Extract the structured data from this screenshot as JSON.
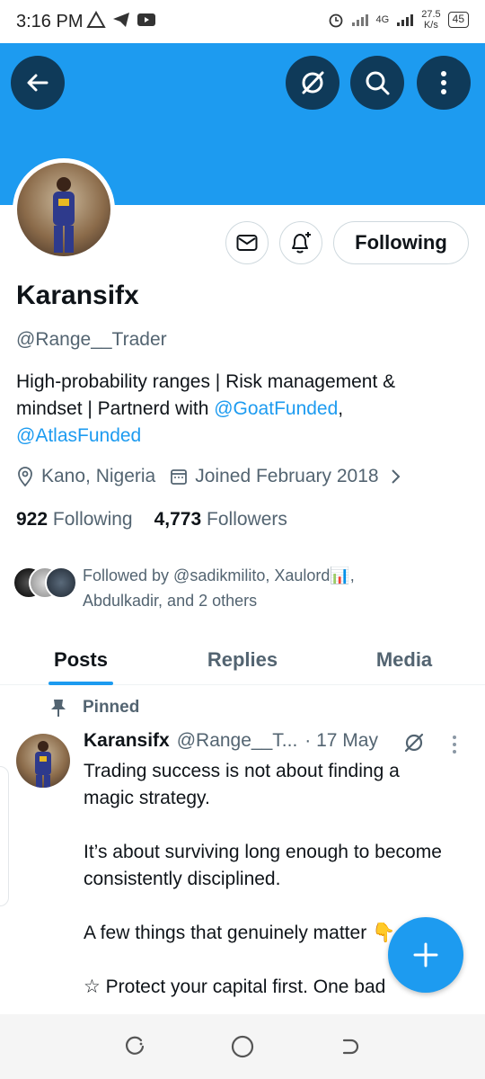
{
  "status_bar": {
    "time": "3:16 PM",
    "network_label": "4G",
    "speed_value": "27.5",
    "speed_unit": "K/s",
    "battery": "45"
  },
  "header": {
    "back_icon": "arrow-left-icon",
    "grok_icon": "grok-icon",
    "search_icon": "search-icon",
    "more_icon": "more-vertical-icon",
    "banner_color": "#1d9bf0"
  },
  "profile": {
    "display_name": "Karansifx",
    "handle": "@Range__Trader",
    "bio_text_1": "High-probability ranges | Risk management & mindset | Partnerd with ",
    "bio_mention_1": "@GoatFunded",
    "bio_text_2": ",",
    "bio_mention_2": "@AtlasFunded",
    "location": "Kano, Nigeria",
    "joined": "Joined February 2018",
    "following_count": "922",
    "following_label": "Following",
    "followers_count": "4,773",
    "followers_label": "Followers",
    "followed_by": "Followed by @sadikmilito, Xaulord📊, Abdulkadir, and 2 others"
  },
  "actions": {
    "message_icon": "mail-icon",
    "notify_icon": "bell-plus-icon",
    "following_label": "Following"
  },
  "tabs": [
    {
      "label": "Posts",
      "active": true
    },
    {
      "label": "Replies",
      "active": false
    },
    {
      "label": "Media",
      "active": false
    }
  ],
  "post": {
    "pinned_label": "Pinned",
    "author": "Karansifx",
    "handle": "@Range__T...",
    "date": "· 17 May",
    "paragraph_1": "Trading success is not about finding a magic strategy.",
    "paragraph_2": "It’s about surviving long enough to become consistently disciplined.",
    "paragraph_3": "A few things that genuinely matter 👇",
    "paragraph_4": "☆ Protect your capital first. One bad"
  },
  "colors": {
    "accent": "#1d9bf0",
    "dark_button": "#0f3a59",
    "secondary_text": "#536471"
  }
}
